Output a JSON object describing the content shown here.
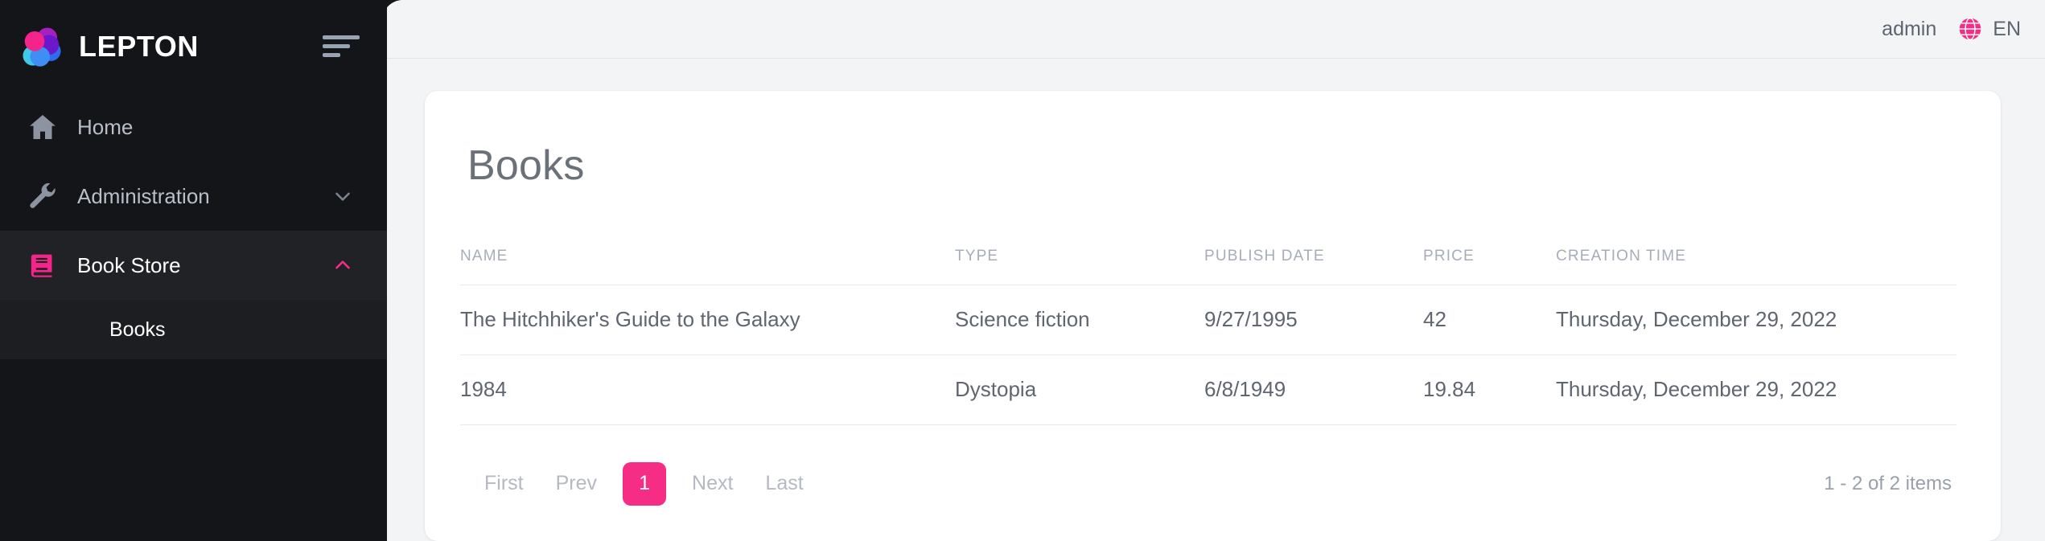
{
  "brand": {
    "name": "LEPTON",
    "logo_icon": "lepton-pinwheel-logo",
    "menu_toggle_icon": "hamburger-menu-icon"
  },
  "sidebar": {
    "items": [
      {
        "label": "Home",
        "icon": "home-icon",
        "has_children": false,
        "state": "default"
      },
      {
        "label": "Administration",
        "icon": "wrench-icon",
        "has_children": true,
        "chevron": "chevron-down-icon",
        "state": "collapsed"
      },
      {
        "label": "Book Store",
        "icon": "book-icon",
        "has_children": true,
        "chevron": "chevron-up-icon",
        "state": "expanded"
      }
    ],
    "children": [
      {
        "label": "Books",
        "parent": "Book Store",
        "active": true
      }
    ]
  },
  "topbar": {
    "user": "admin",
    "language": "EN",
    "globe_icon": "globe-icon"
  },
  "main": {
    "page_title": "Books"
  },
  "table": {
    "columns": [
      {
        "key": "name",
        "label": "NAME"
      },
      {
        "key": "type",
        "label": "TYPE"
      },
      {
        "key": "publish_date",
        "label": "PUBLISH DATE"
      },
      {
        "key": "price",
        "label": "PRICE"
      },
      {
        "key": "creation_time",
        "label": "CREATION TIME"
      }
    ],
    "rows": [
      {
        "name": "The Hitchhiker's Guide to the Galaxy",
        "type": "Science fiction",
        "publish_date": "9/27/1995",
        "price": "42",
        "creation_time": "Thursday, December 29, 2022"
      },
      {
        "name": "1984",
        "type": "Dystopia",
        "publish_date": "6/8/1949",
        "price": "19.84",
        "creation_time": "Thursday, December 29, 2022"
      }
    ]
  },
  "pagination": {
    "first_label": "First",
    "prev_label": "Prev",
    "current_page": "1",
    "next_label": "Next",
    "last_label": "Last",
    "summary": "1 - 2 of 2 items"
  },
  "colors": {
    "accent_pink": "#f52d85",
    "sidebar_bg": "#141519",
    "sidebar_active_bg": "#212226",
    "sidebar_child_bg": "#1d1e22",
    "main_bg": "#f3f4f6",
    "card_bg": "#ffffff",
    "text_muted": "#a7adb8",
    "text_body": "#5f6670"
  }
}
